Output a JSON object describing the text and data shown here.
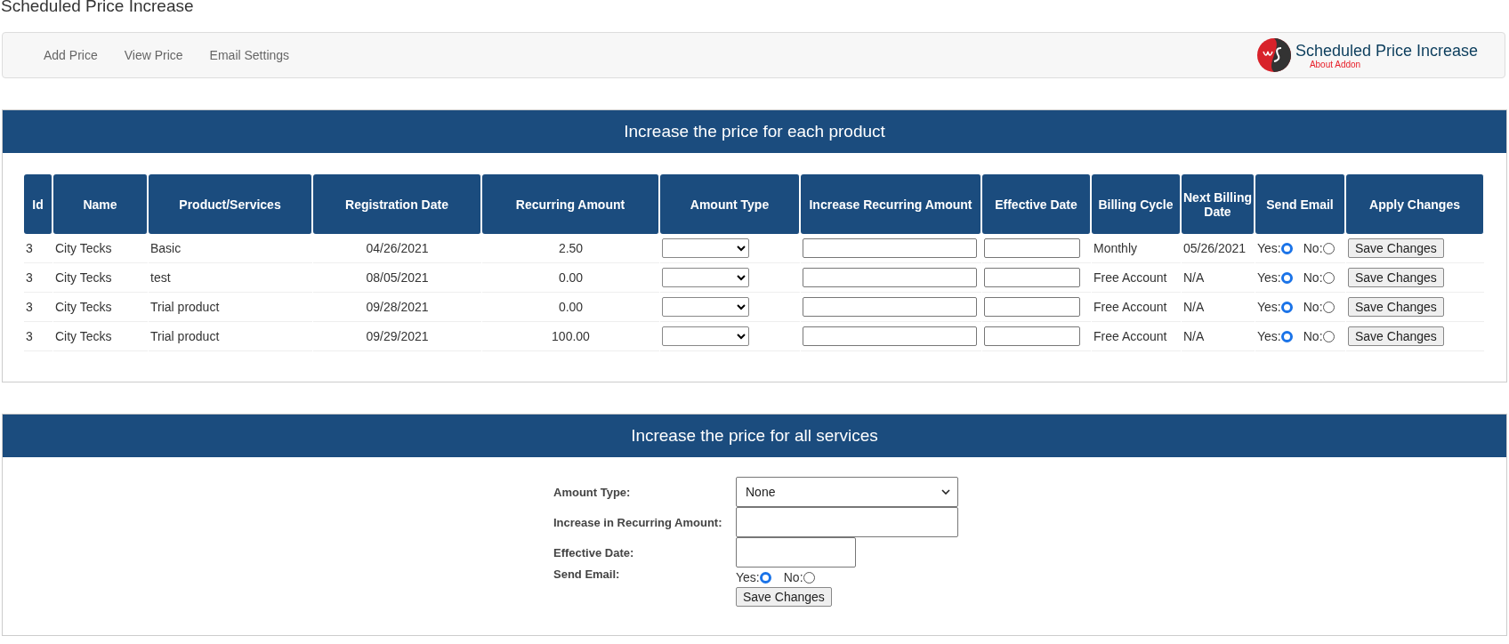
{
  "page_title": "Scheduled Price Increase",
  "nav": {
    "items": [
      "Add Price",
      "View Price",
      "Email Settings"
    ],
    "brand": {
      "title": "Scheduled Price Increase",
      "link": "About Addon"
    }
  },
  "products_panel": {
    "title": "Increase the price for each product",
    "table": {
      "columns": [
        "Id",
        "Name",
        "Product/Services",
        "Registration Date",
        "Recurring Amount",
        "Amount Type",
        "Increase Recurring Amount",
        "Effective Date",
        "Billing Cycle",
        "Next Billing Date",
        "Send Email",
        "Apply Changes"
      ],
      "rows": [
        {
          "id": "3",
          "name": "City Tecks",
          "product": "Basic",
          "registration_date": "04/26/2021",
          "recurring_amount": "2.50",
          "billing_cycle": "Monthly",
          "next_billing_date": "05/26/2021",
          "send_email": [
            {
              "label": "Yes:",
              "selected": true
            },
            {
              "label": "No:",
              "selected": false
            }
          ],
          "button": "Save Changes"
        },
        {
          "id": "3",
          "name": "City Tecks",
          "product": "test",
          "registration_date": "08/05/2021",
          "recurring_amount": "0.00",
          "billing_cycle": "Free Account",
          "next_billing_date": "N/A",
          "send_email": [
            {
              "label": "Yes:",
              "selected": true
            },
            {
              "label": "No:",
              "selected": false
            }
          ],
          "button": "Save Changes"
        },
        {
          "id": "3",
          "name": "City Tecks",
          "product": "Trial product",
          "registration_date": "09/28/2021",
          "recurring_amount": "0.00",
          "billing_cycle": "Free Account",
          "next_billing_date": "N/A",
          "send_email": [
            {
              "label": "Yes:",
              "selected": true
            },
            {
              "label": "No:",
              "selected": false
            }
          ],
          "button": "Save Changes"
        },
        {
          "id": "3",
          "name": "City Tecks",
          "product": "Trial product",
          "registration_date": "09/29/2021",
          "recurring_amount": "100.00",
          "billing_cycle": "Free Account",
          "next_billing_date": "N/A",
          "send_email": [
            {
              "label": "Yes:",
              "selected": true
            },
            {
              "label": "No:",
              "selected": false
            }
          ],
          "button": "Save Changes"
        }
      ]
    }
  },
  "services_panel": {
    "title": "Increase the price for all services",
    "form": {
      "amount_type_label": "Amount Type:",
      "amount_type_value": "None",
      "increase_label": "Increase in Recurring Amount:",
      "effective_date_label": "Effective Date:",
      "send_email_label": "Send Email:",
      "send_email": [
        {
          "label": "Yes:",
          "selected": true
        },
        {
          "label": "No:",
          "selected": false
        }
      ],
      "button": "Save Changes"
    }
  }
}
